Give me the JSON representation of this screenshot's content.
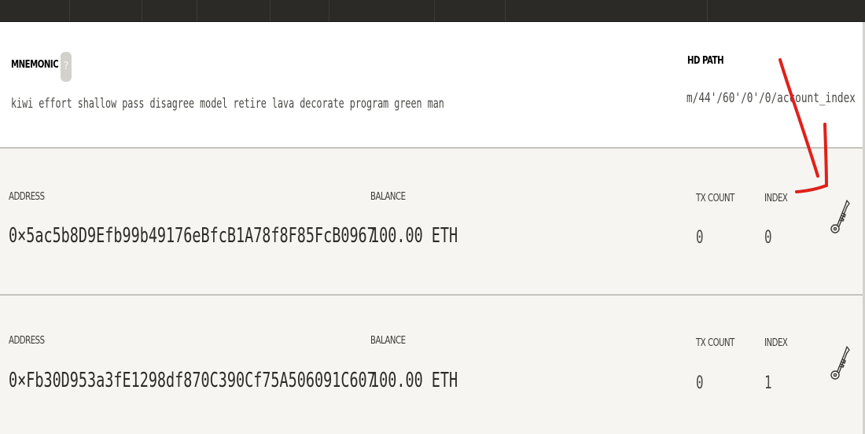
{
  "mnemonic": {
    "label": "MNEMONIC",
    "help": "?",
    "words": "kiwi effort shallow pass disagree model retire lava decorate program green man"
  },
  "hd_path": {
    "label": "HD PATH",
    "value": "m/44'/60'/0'/0/account_index"
  },
  "accounts": [
    {
      "address_label": "ADDRESS",
      "address": "0×5ac5b8D9Efb99b49176eBfcB1A78f8F85FcB0967",
      "balance_label": "BALANCE",
      "balance": "100.00 ETH",
      "tx_count_label": "TX COUNT",
      "tx_count": "0",
      "index_label": "INDEX",
      "index": "0",
      "key_icon": "key-icon"
    },
    {
      "address_label": "ADDRESS",
      "address": "0×Fb30D953a3fE1298df870C390Cf75A506091C607",
      "balance_label": "BALANCE",
      "balance": "100.00 ETH",
      "tx_count_label": "TX COUNT",
      "tx_count": "0",
      "index_label": "INDEX",
      "index": "1",
      "key_icon": "key-icon"
    }
  ],
  "colors": {
    "topbar": "#2b2a27",
    "account_bg": "#f6f5f1",
    "annotation_red": "#e0201b"
  }
}
